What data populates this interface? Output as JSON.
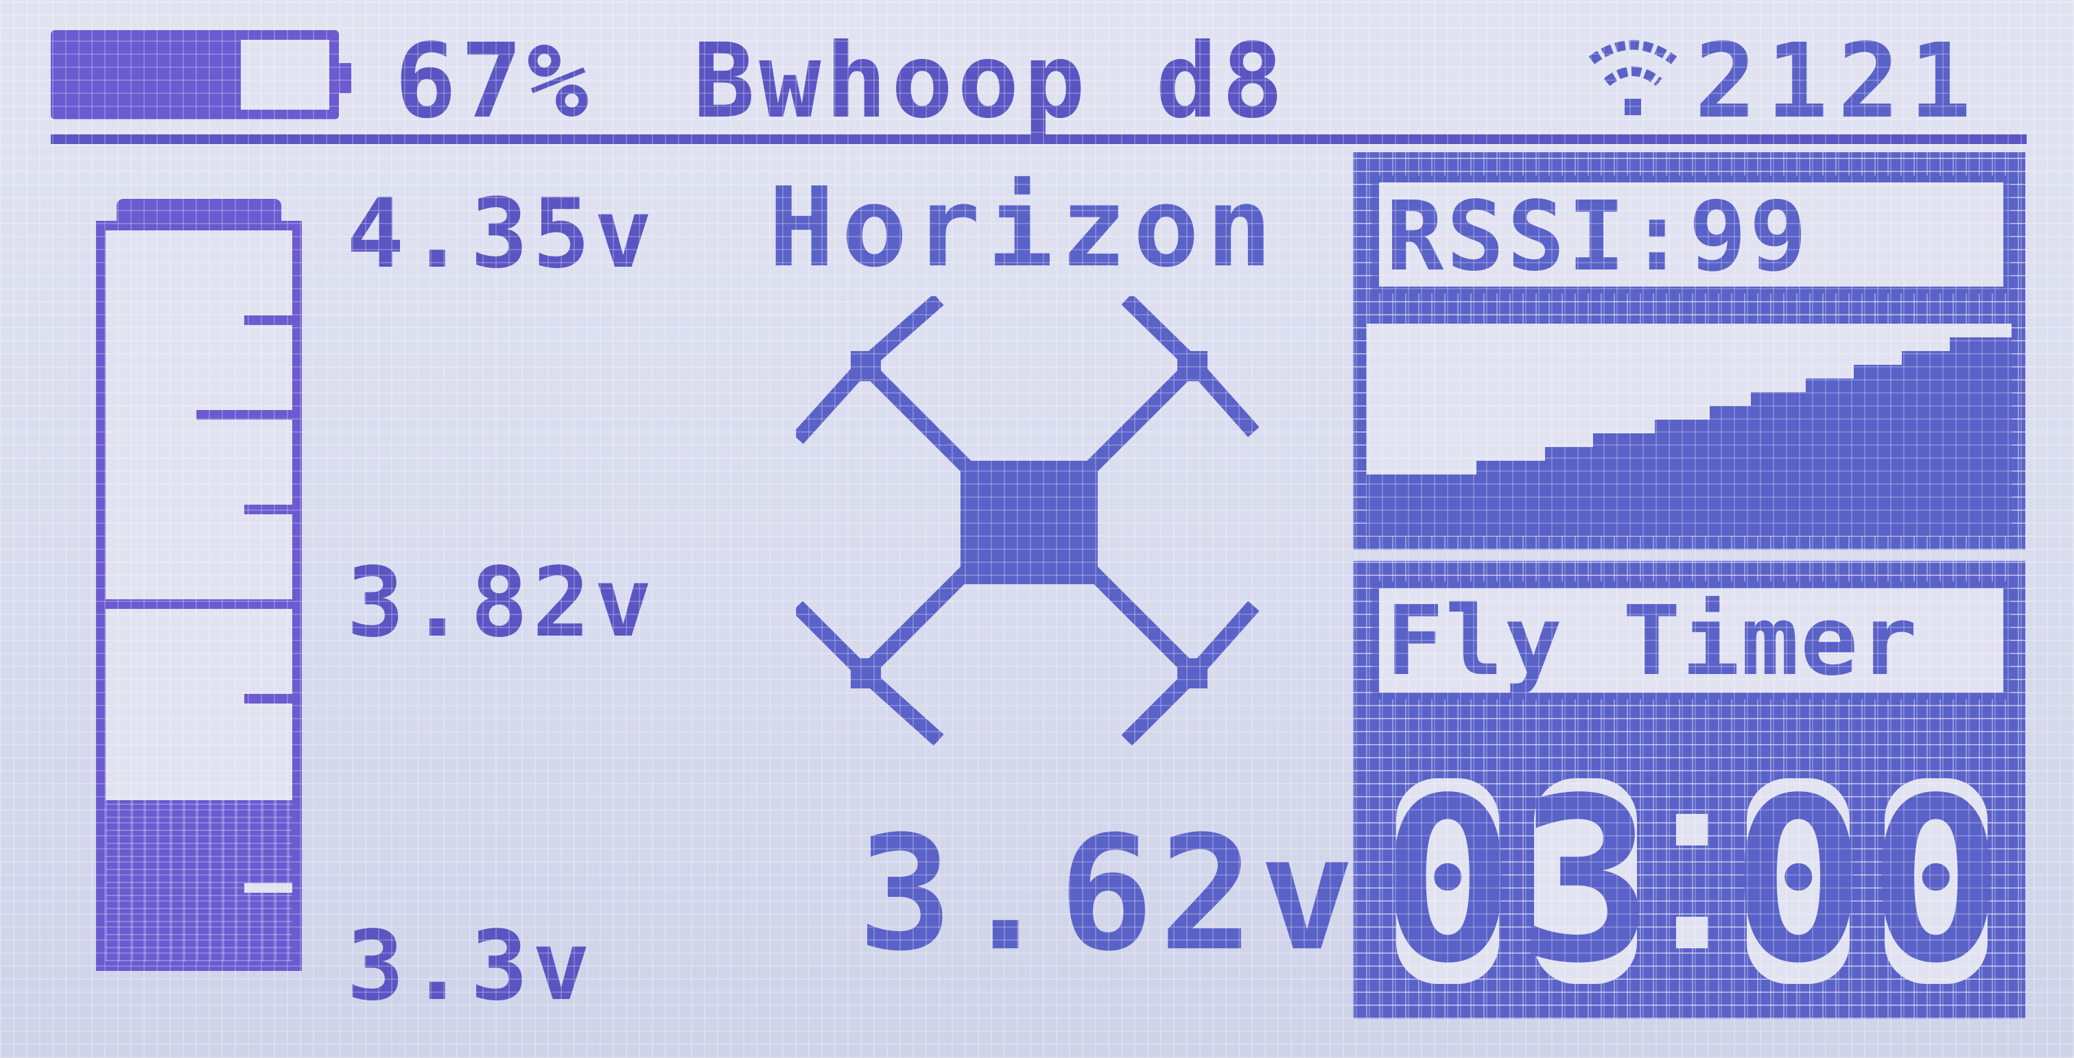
{
  "header": {
    "battery_percent_text": "67%",
    "battery_level": 0.67,
    "model_name": "Bwhoop d8",
    "signal_value": "2121",
    "wifi_icon": "signal-wifi-icon"
  },
  "voltage_gauge": {
    "max_label": "4.35v",
    "mid_label": "3.82v",
    "min_label": "3.3v",
    "level_fraction": 0.22
  },
  "flight": {
    "mode": "Horizon",
    "drone_icon": "quadcopter-icon",
    "current_voltage": "3.62v"
  },
  "rssi": {
    "label": "RSSI:99",
    "value": 99
  },
  "timer": {
    "label": "Fly Timer",
    "digits": [
      "0",
      "3",
      "0",
      "0"
    ],
    "display": "03:00"
  },
  "colors": {
    "lcd_background": "#e1e3f1",
    "ink_purple": "#6b5ad0",
    "ink_blue": "#5a62c8"
  }
}
